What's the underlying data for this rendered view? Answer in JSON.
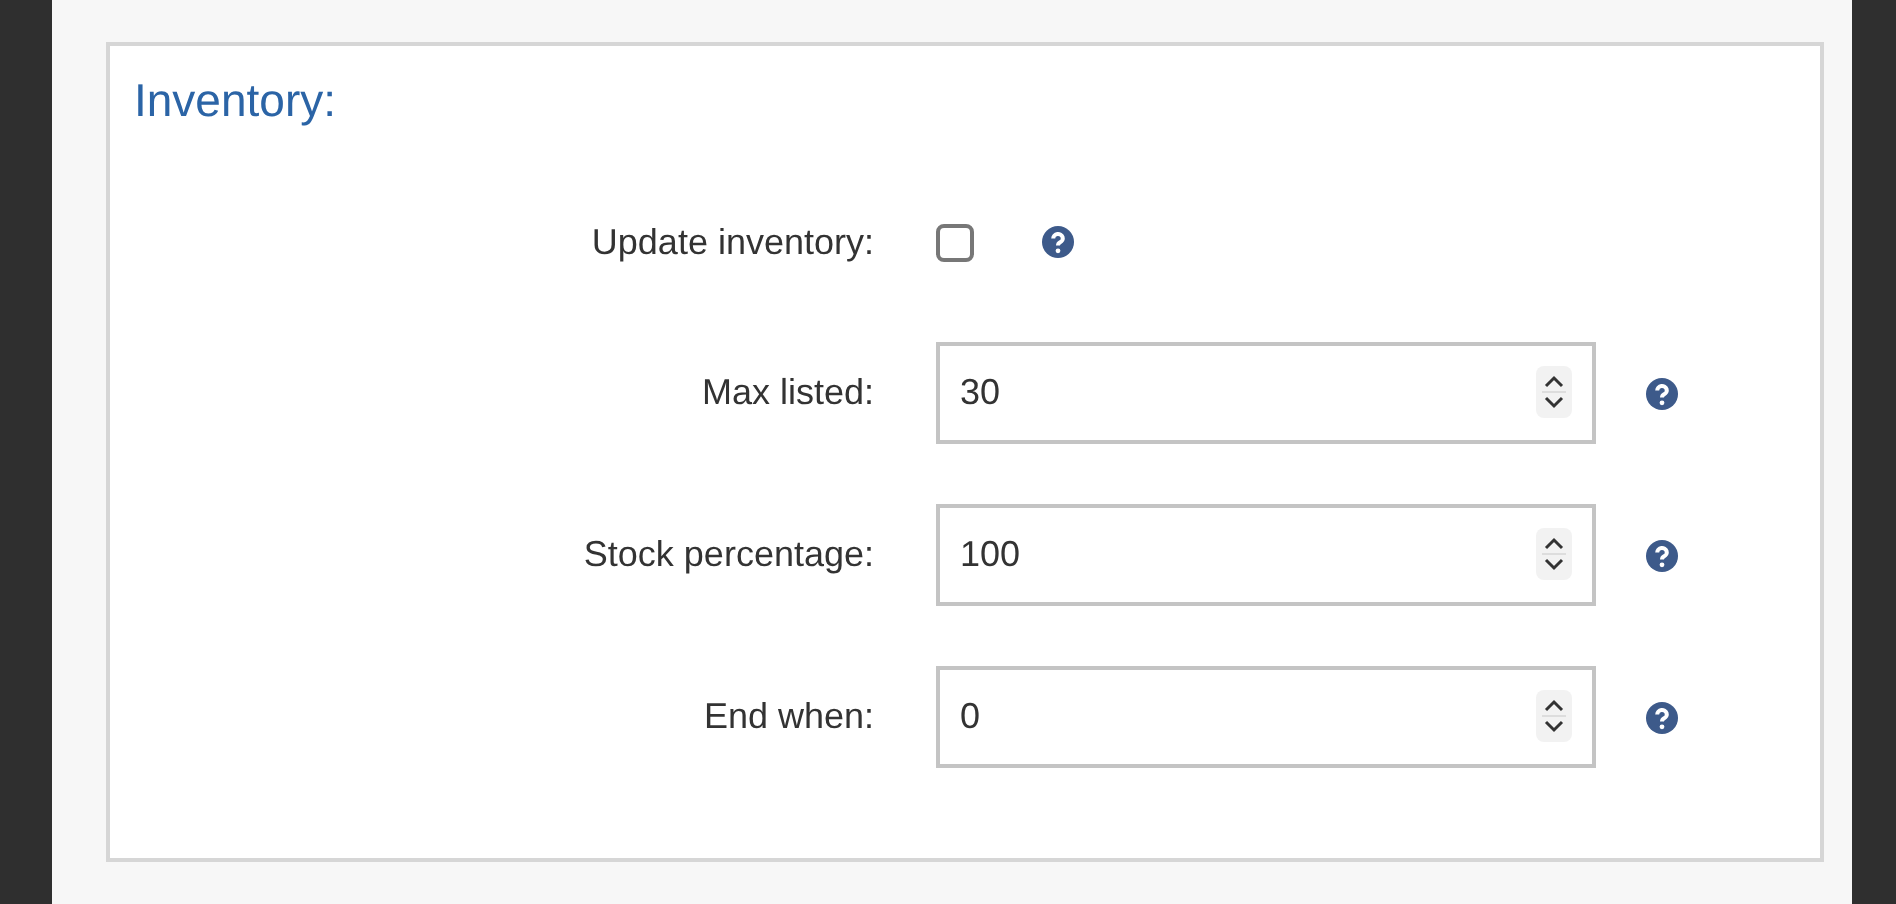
{
  "panel": {
    "title": "Inventory:"
  },
  "fields": [
    {
      "kind": "checkbox",
      "label": "Update inventory:",
      "checked": false
    },
    {
      "kind": "number",
      "label": "Max listed:",
      "value": "30"
    },
    {
      "kind": "number",
      "label": "Stock percentage:",
      "value": "100"
    },
    {
      "kind": "number",
      "label": "End when:",
      "value": "0"
    }
  ]
}
